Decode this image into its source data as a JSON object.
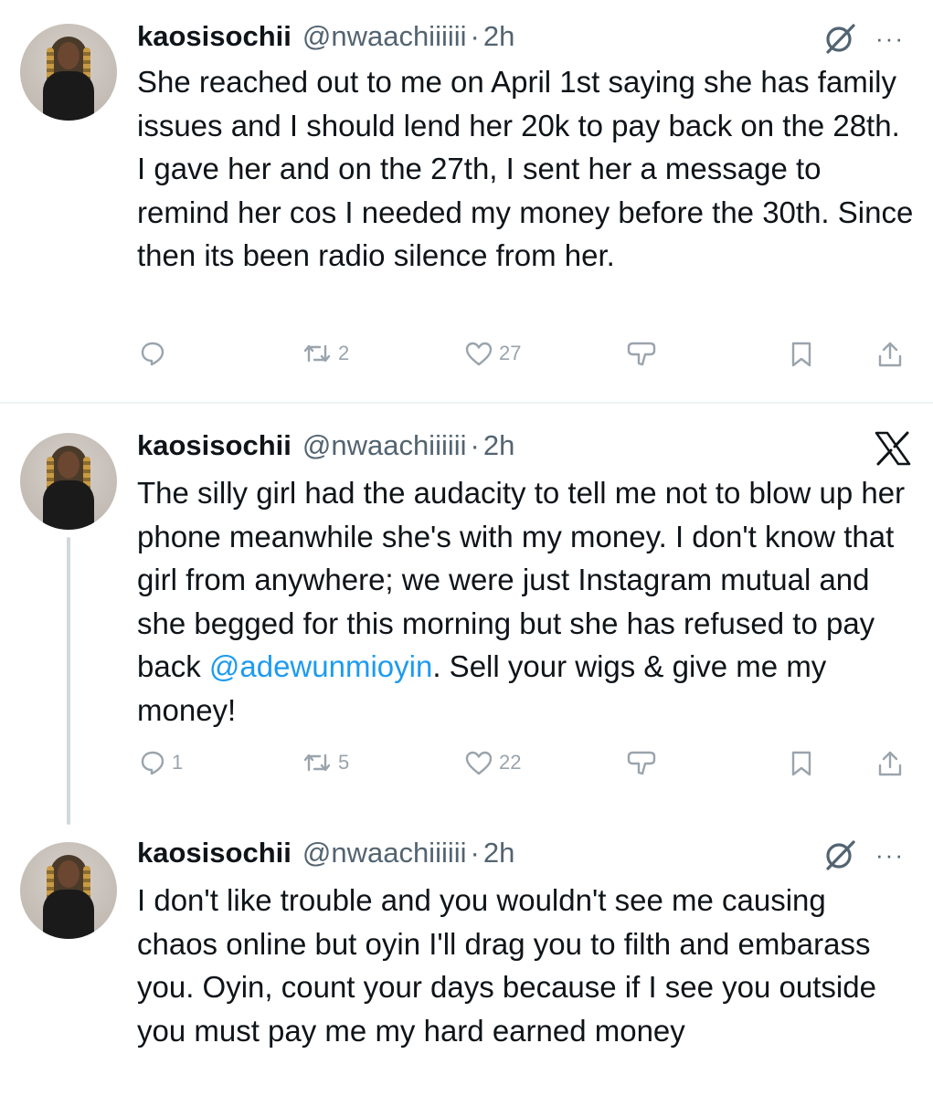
{
  "tweets": [
    {
      "name": "kaosisochii",
      "handle": "@nwaachiiiiii",
      "separator": "·",
      "time": "2h",
      "corner_icon": "grok-slash-icon",
      "text": "She reached out to me on April 1st saying she has family issues and I should lend her 20k to pay back on the 28th. I gave her and on the 27th, I sent her a message to remind her cos I needed my money before the 30th. Since then its been radio silence from her.",
      "replies": "",
      "retweets": "2",
      "likes": "27"
    },
    {
      "name": "kaosisochii",
      "handle": "@nwaachiiiiii",
      "separator": "·",
      "time": "2h",
      "corner_icon": "x-logo-icon",
      "text_before_mention": "The silly girl had the audacity to tell me not to blow up her phone meanwhile she's with my money. I don't know that girl from anywhere; we were just Instagram mutual and she begged for this morning but she has refused to pay back ",
      "mention": "@adewunmioyin",
      "text_after_mention": ". Sell your wigs & give me my money!",
      "replies": "1",
      "retweets": "5",
      "likes": "22"
    },
    {
      "name": "kaosisochii",
      "handle": "@nwaachiiiiii",
      "separator": "·",
      "time": "2h",
      "corner_icon": "grok-slash-icon",
      "text": "I don't like trouble and you wouldn't see me causing chaos online but oyin I'll drag you to filth and embarass you. Oyin, count your days because if I see you outside you must pay me my hard earned money"
    }
  ],
  "more_glyph": "···",
  "colors": {
    "text": "#0f1419",
    "secondary": "#536471",
    "mention": "#1d9bf0",
    "action_icon": "#9aa4ad",
    "divider": "#eff3f4",
    "thread_line": "#cfd9de"
  }
}
